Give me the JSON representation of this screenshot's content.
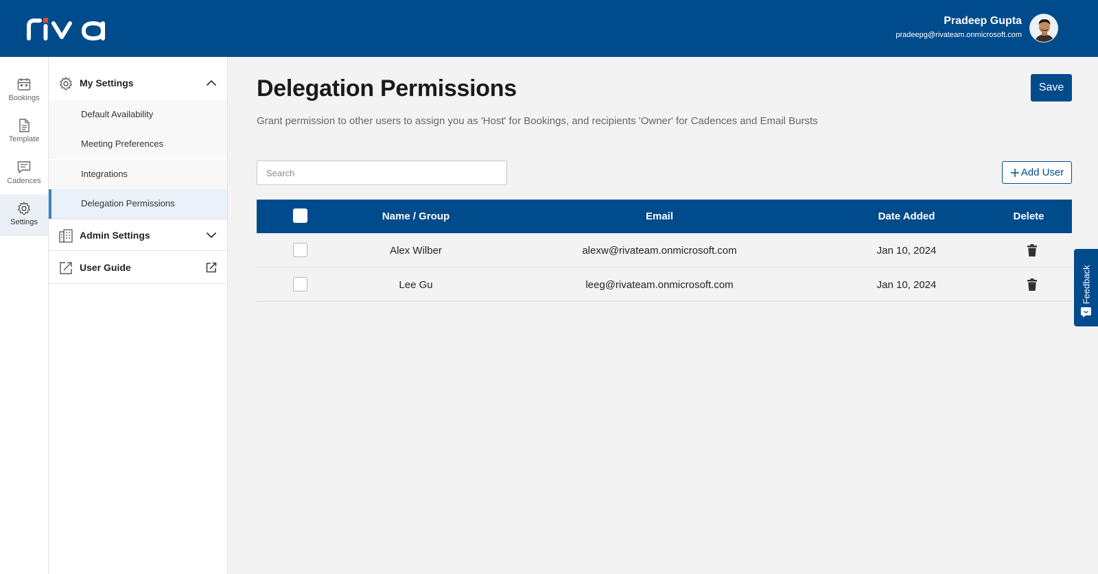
{
  "brand": {
    "logo_text": "riva",
    "primary_color": "#004b8c",
    "accent_color": "#e0453a"
  },
  "user": {
    "name": "Pradeep Gupta",
    "email": "pradeepg@rivateam.onmicrosoft.com"
  },
  "rail": [
    {
      "label": "Bookings",
      "icon": "calendar-icon"
    },
    {
      "label": "Template",
      "icon": "document-icon"
    },
    {
      "label": "Cadences",
      "icon": "message-icon"
    },
    {
      "label": "Settings",
      "icon": "gear-icon",
      "active": true
    }
  ],
  "sidebar": {
    "my_settings": {
      "label": "My Settings",
      "expanded": true,
      "items": [
        {
          "label": "Default Availability"
        },
        {
          "label": "Meeting Preferences"
        },
        {
          "label": "Integrations"
        },
        {
          "label": "Delegation Permissions",
          "active": true
        }
      ]
    },
    "admin_settings": {
      "label": "Admin Settings",
      "expanded": false
    },
    "user_guide": {
      "label": "User Guide"
    }
  },
  "page": {
    "title": "Delegation Permissions",
    "subtitle": "Grant permission to other users to assign you as 'Host' for Bookings, and recipients 'Owner' for Cadences and Email Bursts",
    "save_label": "Save",
    "search_placeholder": "Search",
    "add_user_label": "Add User"
  },
  "table": {
    "columns": [
      "Name / Group",
      "Email",
      "Date Added",
      "Delete"
    ],
    "rows": [
      {
        "name": "Alex Wilber",
        "email": "alexw@rivateam.onmicrosoft.com",
        "date_added": "Jan 10, 2024"
      },
      {
        "name": "Lee Gu",
        "email": "leeg@rivateam.onmicrosoft.com",
        "date_added": "Jan 10, 2024"
      }
    ]
  },
  "feedback": {
    "label": "Feedback"
  }
}
